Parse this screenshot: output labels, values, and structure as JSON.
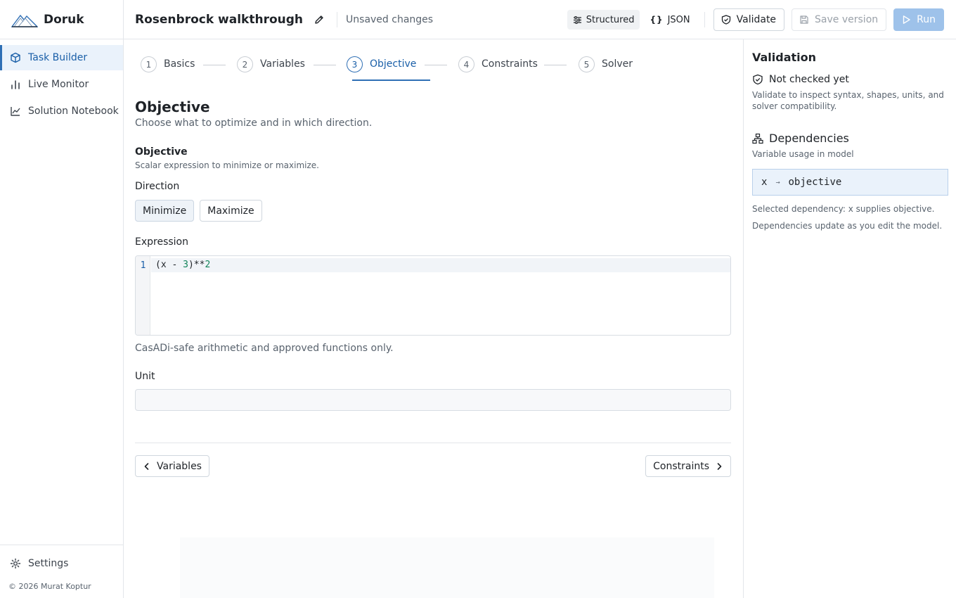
{
  "app": {
    "name": "Doruk"
  },
  "sidebar": {
    "items": [
      {
        "label": "Task Builder",
        "icon": "cube-icon",
        "active": true
      },
      {
        "label": "Live Monitor",
        "icon": "bar-chart-icon",
        "active": false
      },
      {
        "label": "Solution Notebook",
        "icon": "line-chart-icon",
        "active": false
      }
    ],
    "settings_label": "Settings",
    "copyright": "© 2026 Murat Koptur"
  },
  "topbar": {
    "title": "Rosenbrock walkthrough",
    "status": "Unsaved changes",
    "view_structured": "Structured",
    "view_json": "JSON",
    "json_glyph": "{}",
    "validate_label": "Validate",
    "save_label": "Save version",
    "run_label": "Run"
  },
  "steps": [
    {
      "num": "1",
      "label": "Basics"
    },
    {
      "num": "2",
      "label": "Variables"
    },
    {
      "num": "3",
      "label": "Objective"
    },
    {
      "num": "4",
      "label": "Constraints"
    },
    {
      "num": "5",
      "label": "Solver"
    }
  ],
  "objective": {
    "title": "Objective",
    "subtitle": "Choose what to optimize and in which direction.",
    "field_title": "Objective",
    "field_help": "Scalar expression to minimize or maximize.",
    "direction_label": "Direction",
    "minimize_label": "Minimize",
    "maximize_label": "Maximize",
    "selected_direction": "Minimize",
    "expression_label": "Expression",
    "line_number": "1",
    "expr_open": "(x - ",
    "expr_num1": "3",
    "expr_mid": ")**",
    "expr_num2": "2",
    "expression_help": "CasADi-safe arithmetic and approved functions only.",
    "unit_label": "Unit",
    "unit_value": ""
  },
  "footer_nav": {
    "prev_label": "Variables",
    "next_label": "Constraints"
  },
  "validation": {
    "title": "Validation",
    "status": "Not checked yet",
    "help": "Validate to inspect syntax, shapes, units, and solver compatibility."
  },
  "dependencies": {
    "title": "Dependencies",
    "subtitle": "Variable usage in model",
    "from": "x",
    "arrow": "→",
    "to": "objective",
    "selected": "Selected dependency: x supplies objective.",
    "note": "Dependencies update as you edit the model."
  },
  "colors": {
    "accent": "#2f6fb5",
    "accent_text": "#1a5fa8",
    "run_disabled": "#9ec2ea",
    "code_number": "#12845a"
  }
}
